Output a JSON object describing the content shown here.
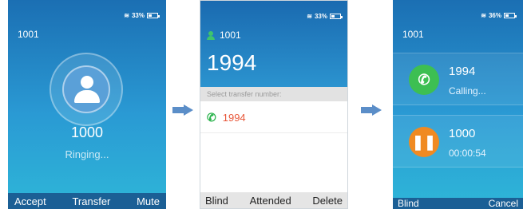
{
  "screen1": {
    "battery": "33%",
    "account": "1001",
    "caller": "1000",
    "state": "Ringing...",
    "softkeys": [
      "Accept",
      "Transfer",
      "Mute"
    ]
  },
  "screen2": {
    "battery": "33%",
    "account": "1001",
    "number": "1994",
    "hint": "Select transfer number:",
    "row_number": "1994",
    "softkeys": [
      "Blind",
      "Attended",
      "Delete"
    ]
  },
  "screen3": {
    "battery": "36%",
    "account": "1001",
    "calls": [
      {
        "number": "1994",
        "status": "Calling..."
      },
      {
        "number": "1000",
        "status": "00:00:54"
      }
    ],
    "softkeys": [
      "Blind",
      "Cancel"
    ]
  },
  "icons": {
    "wifi": "wifi-icon",
    "battery": "battery-icon",
    "avatar": "avatar-icon",
    "phone": "phone-icon",
    "hold": "hold-icon",
    "arrow": "arrow-right-icon"
  },
  "colors": {
    "accent_blue": "#1b6fb3",
    "call_green": "#3dbf52",
    "hold_orange": "#f08a22",
    "number_red": "#e8573a"
  }
}
